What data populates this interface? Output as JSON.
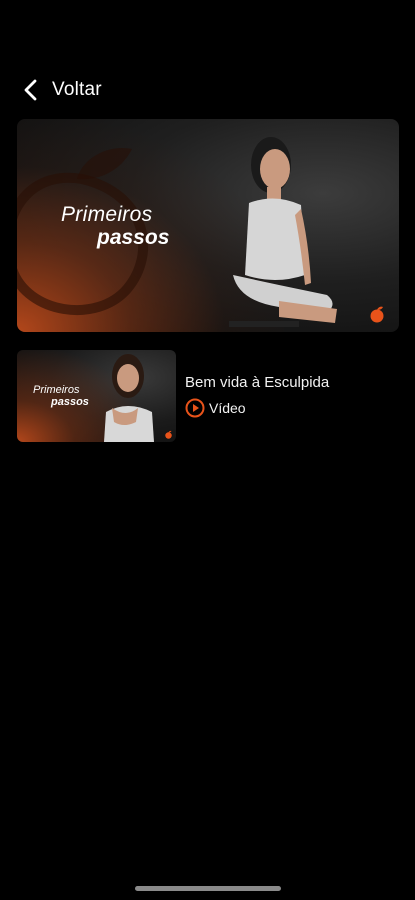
{
  "colors": {
    "background": "#000000",
    "accent": "#e8531a",
    "text": "#ffffff"
  },
  "header": {
    "back_icon": "chevron-left-icon",
    "back_label": "Voltar"
  },
  "banner": {
    "title_line1": "Primeiros",
    "title_line2": "passos",
    "brand_icon": "peach-logo-icon"
  },
  "lessons": [
    {
      "thumb_title_line1": "Primeiros",
      "thumb_title_line2": "passos",
      "title": "Bem vida à Esculpida",
      "type_icon": "play-circle-icon",
      "type_label": "Vídeo"
    }
  ]
}
